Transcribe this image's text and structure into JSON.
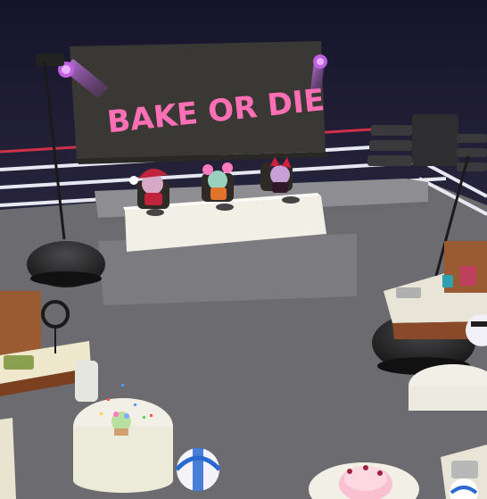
{
  "scene": {
    "banner": {
      "title": "BAKE OR DIE",
      "title_color": "#ff6fb5"
    },
    "colors": {
      "sky_top": "#1a1830",
      "sky_bottom": "#3a3650",
      "floor": "#6f6f72",
      "stage": "#8a8a8c",
      "tablecloth": "#f2f0e6",
      "rope_red": "#c83048",
      "rope_white": "#e8e8f0",
      "lamp": "#2a2a2c",
      "spot_purple": "#c060e0",
      "counter_wood": "#8a4a2a"
    },
    "judges": [
      {
        "name": "santa-hat-judge",
        "accent": "#c0243c"
      },
      {
        "name": "pink-pigtail-judge",
        "accent": "#ff7ac0"
      },
      {
        "name": "red-devil-judge",
        "accent": "#d02040"
      }
    ]
  }
}
